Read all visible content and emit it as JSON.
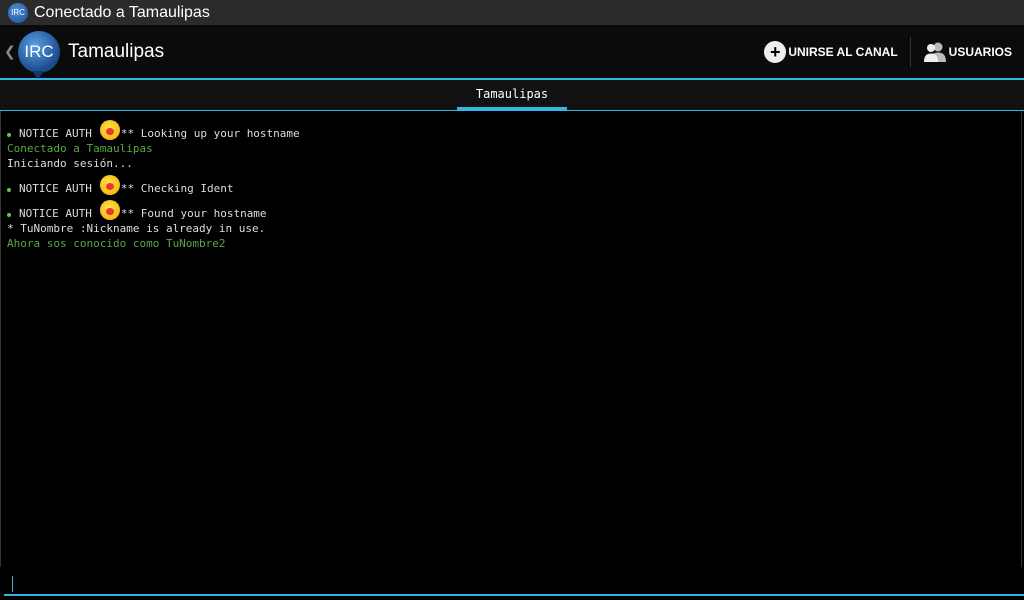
{
  "window": {
    "title": "Conectado a Tamaulipas",
    "icon_label": "IRC"
  },
  "actionbar": {
    "logo_label": "IRC",
    "title": "Tamaulipas",
    "join_label": "UNIRSE AL CANAL",
    "users_label": "USUARIOS"
  },
  "tabs": [
    {
      "label": "Tamaulipas"
    }
  ],
  "messages": [
    {
      "prefix": "NOTICE AUTH",
      "text": "** Looking up your hostname"
    },
    {
      "text": "Conectado a Tamaulipas"
    },
    {
      "text": "Iniciando sesión..."
    },
    {
      "prefix": "NOTICE AUTH",
      "text": "** Checking Ident"
    },
    {
      "prefix": "NOTICE AUTH",
      "text": "** Found your hostname"
    },
    {
      "text": "* TuNombre :Nickname is already in use."
    },
    {
      "text": "Ahora sos conocido como TuNombre2"
    }
  ],
  "input": {
    "value": "",
    "placeholder": ""
  },
  "colors": {
    "accent": "#33b5e5",
    "status_green": "#5aa646",
    "notice_bullet": "#6cbf4f"
  },
  "icons": {
    "back": "chevron-left-icon",
    "join": "plus-circle-icon",
    "users": "users-icon",
    "notice": "smiley-emoji-icon"
  }
}
